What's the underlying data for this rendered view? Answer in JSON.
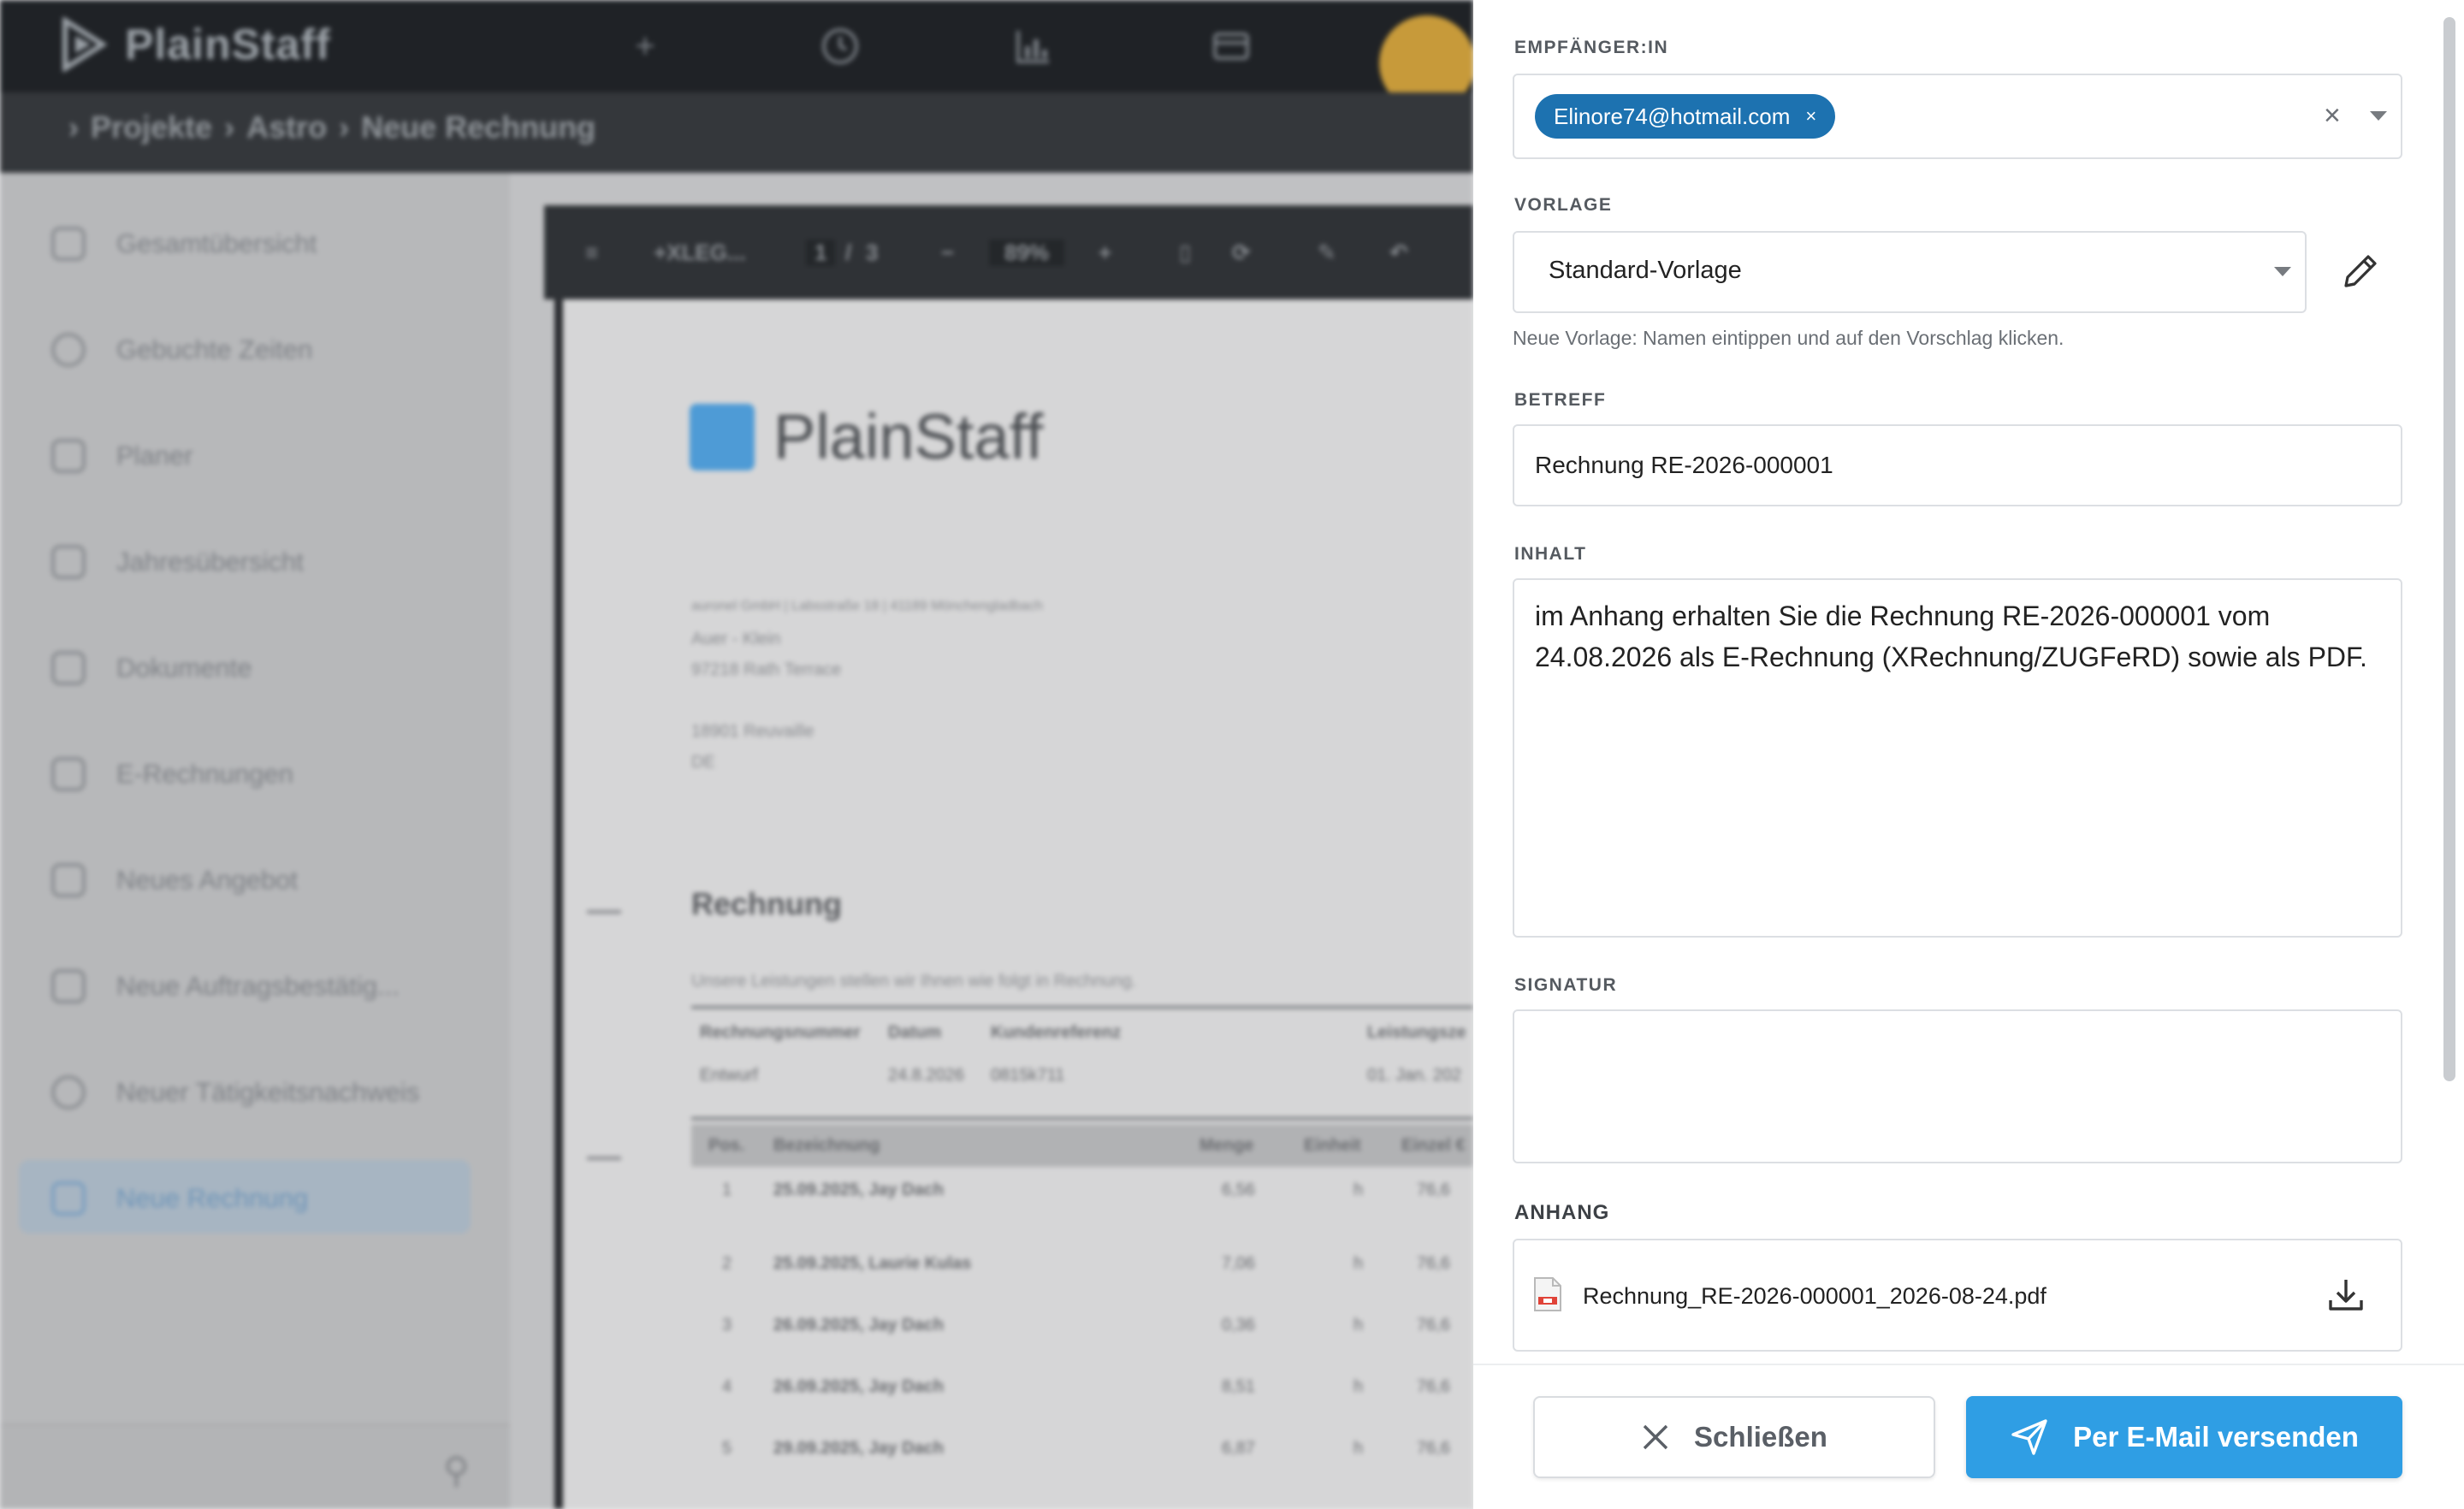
{
  "app": {
    "logo_text": "PlainStaff",
    "breadcrumb": [
      "Projekte",
      "Astro",
      "Neue Rechnung"
    ],
    "sidebar": [
      "Gesamtübersicht",
      "Gebuchte Zeiten",
      "Planer",
      "Jahresübersicht",
      "Dokumente",
      "E-Rechnungen",
      "Neues Angebot",
      "Neue Auftragsbestätig...",
      "Neuer Tätigkeitsnachweis",
      "Neue Rechnung"
    ],
    "active_item": "Neue Rechnung",
    "pdf_toolbar": {
      "title": "+XLEG...",
      "page": "1",
      "pages": "3",
      "zoom": "89%"
    },
    "document": {
      "logo_text": "PlainStaff",
      "title": "Rechnung",
      "intro": "Unsere Leistungen stellen wir Ihnen wie folgt in Rechnung.",
      "address": [
        "Auer - Klein",
        "97218 Rath Terrace",
        "18901 Reuvaille",
        "DE"
      ],
      "sender_line": "auronel GmbH | Labsstraße 18 | 41189 Mönchengladbach",
      "meta_headers": [
        "Rechnungsnummer",
        "Datum",
        "Kundenreferenz",
        "Leistungsze"
      ],
      "meta_values": [
        "Entwurf",
        "24.8.2026",
        "0815k711",
        "01. Jan. 202"
      ],
      "item_headers": [
        "Pos.",
        "Bezeichnung",
        "Menge",
        "Einheit",
        "Einzel €"
      ],
      "items": [
        {
          "pos": "1",
          "desc": "25.09.2025, Jay Dach",
          "qty": "6,56",
          "unit": "h",
          "price": "76,6"
        },
        {
          "pos": "2",
          "desc": "25.09.2025, Laurie Kulas",
          "qty": "7,06",
          "unit": "h",
          "price": "76,6"
        },
        {
          "pos": "3",
          "desc": "26.09.2025, Jay Dach",
          "qty": "0,36",
          "unit": "h",
          "price": "76,6"
        },
        {
          "pos": "4",
          "desc": "26.09.2025, Jay Dach",
          "qty": "8,51",
          "unit": "h",
          "price": "76,6"
        },
        {
          "pos": "5",
          "desc": "29.09.2025, Jay Dach",
          "qty": "6,87",
          "unit": "h",
          "price": "76,6"
        }
      ]
    }
  },
  "dialog": {
    "recipient_label": "EMPFÄNGER:IN",
    "recipient_chip": "Elinore74@hotmail.com",
    "template_label": "VORLAGE",
    "template_value": "Standard-Vorlage",
    "template_hint": "Neue Vorlage: Namen eintippen und auf den Vorschlag klicken.",
    "subject_label": "BETREFF",
    "subject_value": "Rechnung RE-2026-000001",
    "content_label": "INHALT",
    "content_value": "im Anhang erhalten Sie die Rechnung RE-2026-000001 vom 24.08.2026 als E-Rechnung (XRechnung/ZUGFeRD) sowie als PDF.",
    "signature_label": "SIGNATUR",
    "signature_value": "",
    "attachment_label": "ANHANG",
    "attachment_name": "Rechnung_RE-2026-000001_2026-08-24.pdf",
    "close_label": "Schließen",
    "send_label": "Per E-Mail versenden"
  },
  "colors": {
    "accent": "#2f9ee4",
    "chip": "#1d72b0",
    "brand_gold": "#c79a3a"
  },
  "icons": [
    "plus-icon",
    "clock-icon",
    "chart-icon",
    "mail-icon",
    "briefcase-icon",
    "pencil-icon",
    "download-icon",
    "pdf-file-icon",
    "close-icon",
    "send-icon",
    "pin-icon"
  ]
}
